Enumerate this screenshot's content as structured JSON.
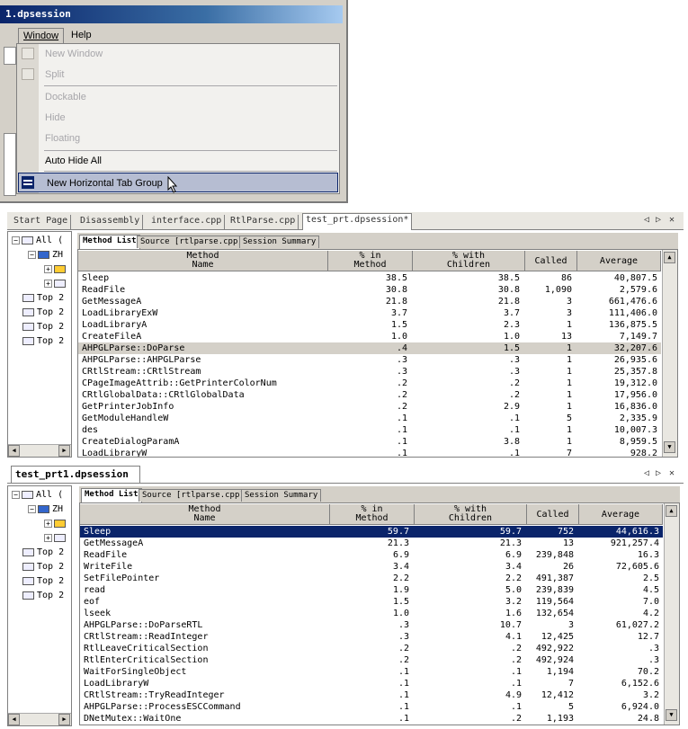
{
  "window": {
    "title": "1.dpsession",
    "menubar": {
      "window": "Window",
      "help": "Help"
    }
  },
  "menu": {
    "items": [
      {
        "label": "New Window",
        "enabled": false
      },
      {
        "label": "Split",
        "enabled": false
      },
      {
        "label": "Dockable",
        "enabled": false
      },
      {
        "label": "Hide",
        "enabled": false
      },
      {
        "label": "Floating",
        "enabled": false
      },
      {
        "label": "Auto Hide All",
        "enabled": true
      },
      {
        "label": "New Horizontal Tab Group",
        "enabled": true
      }
    ]
  },
  "doc_tabs": [
    "Start Page",
    "Disassembly",
    "interface.cpp",
    "RtlParse.cpp",
    "test_prt.dpsession*"
  ],
  "tree": {
    "all": "All (",
    "zh": "ZH",
    "top": "Top 2"
  },
  "subtabs": [
    "Method List",
    "Source [rtlparse.cpp]",
    "Session Summary"
  ],
  "columns": {
    "method": "Method\nName",
    "pct": "% in\nMethod",
    "pctc": "% with\nChildren",
    "called": "Called",
    "avg": "Average"
  },
  "pane1": {
    "rows": [
      [
        "Sleep",
        "38.5",
        "38.5",
        "86",
        "40,807.5"
      ],
      [
        "ReadFile",
        "30.8",
        "30.8",
        "1,090",
        "2,579.6"
      ],
      [
        "GetMessageA",
        "21.8",
        "21.8",
        "3",
        "661,476.6"
      ],
      [
        "LoadLibraryExW",
        "3.7",
        "3.7",
        "3",
        "111,406.0"
      ],
      [
        "LoadLibraryA",
        "1.5",
        "2.3",
        "1",
        "136,875.5"
      ],
      [
        "CreateFileA",
        "1.0",
        "1.0",
        "13",
        "7,149.7"
      ],
      [
        "AHPGLParse::DoParse",
        ".4",
        "1.5",
        "1",
        "32,207.6"
      ],
      [
        "AHPGLParse::AHPGLParse",
        ".3",
        ".3",
        "1",
        "26,935.6"
      ],
      [
        "CRtlStream::CRtlStream",
        ".3",
        ".3",
        "1",
        "25,357.8"
      ],
      [
        "CPageImageAttrib::GetPrinterColorNum",
        ".2",
        ".2",
        "1",
        "19,312.0"
      ],
      [
        "CRtlGlobalData::CRtlGlobalData",
        ".2",
        ".2",
        "1",
        "17,956.0"
      ],
      [
        "GetPrinterJobInfo",
        ".2",
        "2.9",
        "1",
        "16,836.0"
      ],
      [
        "GetModuleHandleW",
        ".1",
        ".1",
        "5",
        "2,335.9"
      ],
      [
        "des",
        ".1",
        ".1",
        "1",
        "10,007.3"
      ],
      [
        "CreateDialogParamA",
        ".1",
        "3.8",
        "1",
        "8,959.5"
      ],
      [
        "LoadLibraryW",
        ".1",
        ".1",
        "7",
        "928.2"
      ]
    ]
  },
  "pane2": {
    "title": "test_prt1.dpsession",
    "rows": [
      [
        "Sleep",
        "59.7",
        "59.7",
        "752",
        "44,616.3"
      ],
      [
        "GetMessageA",
        "21.3",
        "21.3",
        "13",
        "921,257.4"
      ],
      [
        "ReadFile",
        "6.9",
        "6.9",
        "239,848",
        "16.3"
      ],
      [
        "WriteFile",
        "3.4",
        "3.4",
        "26",
        "72,605.6"
      ],
      [
        "SetFilePointer",
        "2.2",
        "2.2",
        "491,387",
        "2.5"
      ],
      [
        "read",
        "1.9",
        "5.0",
        "239,839",
        "4.5"
      ],
      [
        "eof",
        "1.5",
        "3.2",
        "119,564",
        "7.0"
      ],
      [
        "lseek",
        "1.0",
        "1.6",
        "132,654",
        "4.2"
      ],
      [
        "AHPGLParse::DoParseRTL",
        ".3",
        "10.7",
        "3",
        "61,027.2"
      ],
      [
        "CRtlStream::ReadInteger",
        ".3",
        "4.1",
        "12,425",
        "12.7"
      ],
      [
        "RtlLeaveCriticalSection",
        ".2",
        ".2",
        "492,922",
        ".3"
      ],
      [
        "RtlEnterCriticalSection",
        ".2",
        ".2",
        "492,924",
        ".3"
      ],
      [
        "WaitForSingleObject",
        ".1",
        ".1",
        "1,194",
        "70.2"
      ],
      [
        "LoadLibraryW",
        ".1",
        ".1",
        "7",
        "6,152.6"
      ],
      [
        "CRtlStream::TryReadInteger",
        ".1",
        "4.9",
        "12,412",
        "3.2"
      ],
      [
        "AHPGLParse::ProcessESCCommand",
        ".1",
        ".1",
        "5",
        "6,924.0"
      ],
      [
        "DNetMutex::WaitOne",
        ".1",
        ".2",
        "1,193",
        "24.8"
      ]
    ]
  }
}
